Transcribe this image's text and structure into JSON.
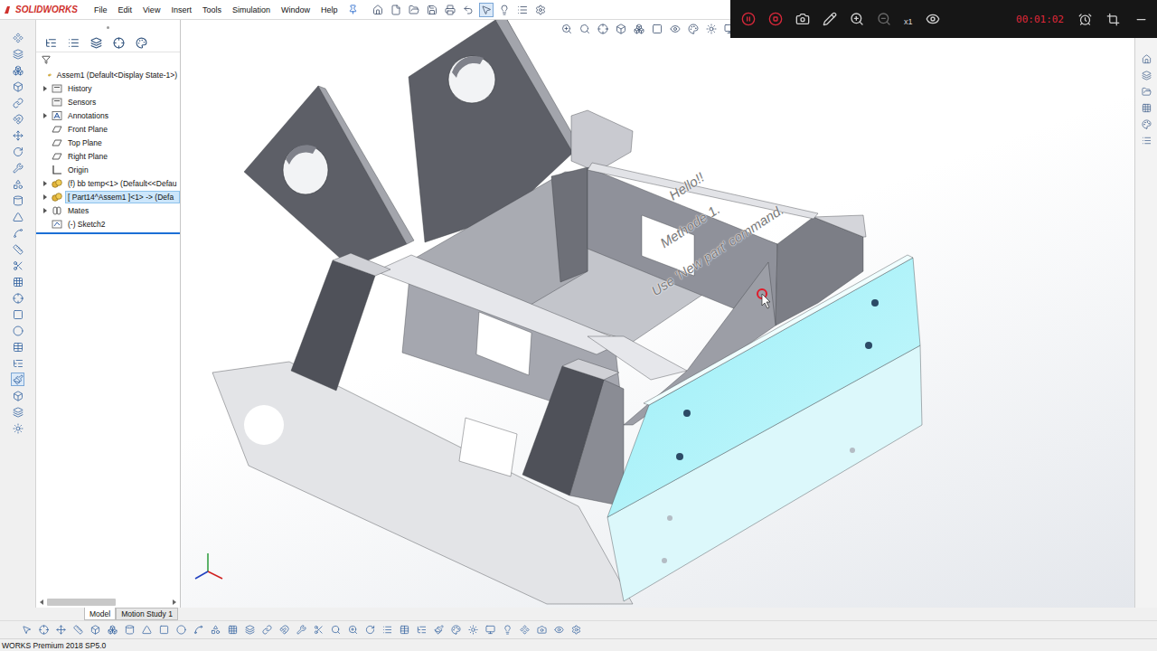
{
  "app": {
    "logo": "SOLIDWORKS"
  },
  "menu": [
    {
      "label": "File"
    },
    {
      "label": "Edit"
    },
    {
      "label": "View"
    },
    {
      "label": "Insert"
    },
    {
      "label": "Tools"
    },
    {
      "label": "Simulation"
    },
    {
      "label": "Window"
    },
    {
      "label": "Help"
    }
  ],
  "recorder": {
    "time": "00:01:02",
    "speed": "x1"
  },
  "feature_tree": {
    "items": [
      {
        "label": "Assem1 (Default<Display State-1>)",
        "kind": "assembly",
        "depth": 0,
        "expandable": false,
        "expanded": false,
        "selected": false
      },
      {
        "label": "History",
        "kind": "folder",
        "depth": 1,
        "expandable": true,
        "expanded": false,
        "selected": false
      },
      {
        "label": "Sensors",
        "kind": "folder",
        "depth": 1,
        "expandable": false,
        "expanded": false,
        "selected": false
      },
      {
        "label": "Annotations",
        "kind": "annotation",
        "depth": 1,
        "expandable": true,
        "expanded": false,
        "selected": false
      },
      {
        "label": "Front Plane",
        "kind": "plane",
        "depth": 1,
        "expandable": false,
        "expanded": false,
        "selected": false
      },
      {
        "label": "Top Plane",
        "kind": "plane",
        "depth": 1,
        "expandable": false,
        "expanded": false,
        "selected": false
      },
      {
        "label": "Right Plane",
        "kind": "plane",
        "depth": 1,
        "expandable": false,
        "expanded": false,
        "selected": false
      },
      {
        "label": "Origin",
        "kind": "origin",
        "depth": 1,
        "expandable": false,
        "expanded": false,
        "selected": false
      },
      {
        "label": "(f) bb temp<1> (Default<<Defau",
        "kind": "part",
        "depth": 1,
        "expandable": true,
        "expanded": false,
        "selected": false
      },
      {
        "label": "[ Part14^Assem1 ]<1> -> (Defa",
        "kind": "part",
        "depth": 1,
        "expandable": true,
        "expanded": false,
        "selected": true
      },
      {
        "label": "Mates",
        "kind": "mates",
        "depth": 1,
        "expandable": true,
        "expanded": false,
        "selected": false
      },
      {
        "label": "(-) Sketch2",
        "kind": "sketch",
        "depth": 1,
        "expandable": false,
        "expanded": false,
        "selected": false
      }
    ]
  },
  "viewport": {
    "notes": [
      "Hello!!",
      "Methode 1.",
      "Use 'New part' command."
    ]
  },
  "tabs": [
    {
      "label": "Model",
      "selected": true
    },
    {
      "label": "Motion Study 1",
      "selected": false
    }
  ],
  "status_bar": {
    "text": "WORKS Premium 2018 SP5.0"
  }
}
